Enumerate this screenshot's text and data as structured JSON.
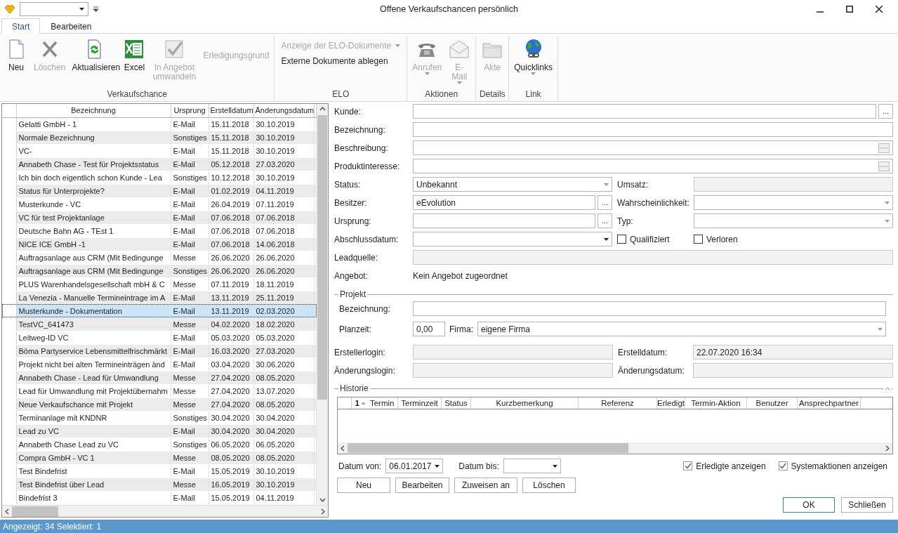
{
  "window": {
    "title": "Offene Verkaufschancen persönlich"
  },
  "tabs": [
    {
      "label": "Start",
      "selected": true
    },
    {
      "label": "Bearbeiten",
      "selected": false
    }
  ],
  "ribbon": {
    "groups": [
      {
        "label": "Verkaufschance",
        "items": [
          {
            "kind": "large",
            "label": "Neu",
            "disabled": false
          },
          {
            "kind": "large",
            "label": "Löschen",
            "disabled": true
          },
          {
            "kind": "large",
            "label": "Aktualisieren",
            "disabled": false
          },
          {
            "kind": "large",
            "label": "Excel",
            "disabled": false
          },
          {
            "kind": "large",
            "label": "In Angebot umwandeln",
            "disabled": true
          },
          {
            "kind": "text",
            "label": "Erledigungsgrund",
            "disabled": true
          }
        ]
      },
      {
        "label": "ELO",
        "items": [
          {
            "kind": "small",
            "label": "Anzeige der ELO-Dokumente",
            "disabled": true,
            "dropdown": true
          },
          {
            "kind": "small",
            "label": "Externe Dokumente ablegen",
            "disabled": false,
            "dropdown": false
          }
        ]
      },
      {
        "label": "Aktionen",
        "items": [
          {
            "kind": "large",
            "label": "Anrufen",
            "disabled": true,
            "dropdown": true
          },
          {
            "kind": "large",
            "label": "E-Mail",
            "disabled": true,
            "dropdown": true
          }
        ]
      },
      {
        "label": "Details",
        "items": [
          {
            "kind": "large",
            "label": "Akte",
            "disabled": true
          }
        ]
      },
      {
        "label": "Link",
        "items": [
          {
            "kind": "large",
            "label": "Quicklinks",
            "disabled": false,
            "dropdown": true
          }
        ]
      }
    ]
  },
  "table": {
    "columns": [
      "Bezeichnung",
      "Ursprung",
      "Erstelldatum",
      "Änderungsdatum"
    ],
    "rows": [
      {
        "bezeichnung": "Gelatti GmbH - 1",
        "ursprung": "E-Mail",
        "erstelldatum": "15.11.2018",
        "aenderungsdatum": "30.10.2019",
        "selected": false
      },
      {
        "bezeichnung": "Normale Bezeichnung",
        "ursprung": "Sonstiges",
        "erstelldatum": "15.11.2018",
        "aenderungsdatum": "30.10.2019",
        "selected": false
      },
      {
        "bezeichnung": "VC-",
        "ursprung": "E-Mail",
        "erstelldatum": "15.11.2018",
        "aenderungsdatum": "30.10.2019",
        "selected": false
      },
      {
        "bezeichnung": "Annabeth Chase - Test für Projektsstatus",
        "ursprung": "E-Mail",
        "erstelldatum": "05.12.2018",
        "aenderungsdatum": "27.03.2020",
        "selected": false
      },
      {
        "bezeichnung": "Ich bin doch eigentlich schon Kunde - Lea",
        "ursprung": "Sonstiges",
        "erstelldatum": "10.12.2018",
        "aenderungsdatum": "30.10.2019",
        "selected": false
      },
      {
        "bezeichnung": "Status für Unterprojekte?",
        "ursprung": "E-Mail",
        "erstelldatum": "01.02.2019",
        "aenderungsdatum": "04.11.2019",
        "selected": false
      },
      {
        "bezeichnung": "Musterkunde  - VC",
        "ursprung": "E-Mail",
        "erstelldatum": "26.04.2019",
        "aenderungsdatum": "07.11.2019",
        "selected": false
      },
      {
        "bezeichnung": "VC für test Projektanlage",
        "ursprung": "E-Mail",
        "erstelldatum": "07.06.2018",
        "aenderungsdatum": "07.06.2018",
        "selected": false
      },
      {
        "bezeichnung": "Deutsche Bahn AG - TEst 1",
        "ursprung": "E-Mail",
        "erstelldatum": "07.06.2018",
        "aenderungsdatum": "07.06.2018",
        "selected": false
      },
      {
        "bezeichnung": "NICE ICE GmbH -1",
        "ursprung": "E-Mail",
        "erstelldatum": "07.06.2018",
        "aenderungsdatum": "14.06.2018",
        "selected": false
      },
      {
        "bezeichnung": "Auftragsanlage aus CRM (Mit Bedingunge",
        "ursprung": "Messe",
        "erstelldatum": "26.06.2020",
        "aenderungsdatum": "26.06.2020",
        "selected": false
      },
      {
        "bezeichnung": "Auftragsanlage aus CRM (Mit Bedingunge",
        "ursprung": "Sonstiges",
        "erstelldatum": "26.06.2020",
        "aenderungsdatum": "26.06.2020",
        "selected": false
      },
      {
        "bezeichnung": "PLUS Warenhandelsgesellschaft mbH & C",
        "ursprung": "Messe",
        "erstelldatum": "07.11.2019",
        "aenderungsdatum": "18.11.2019",
        "selected": false
      },
      {
        "bezeichnung": "La Venezia - Manuelle Termineintrage im A",
        "ursprung": "E-Mail",
        "erstelldatum": "13.11.2019",
        "aenderungsdatum": "25.11.2019",
        "selected": false
      },
      {
        "bezeichnung": "Musterkunde - Dokumentation",
        "ursprung": "E-Mail",
        "erstelldatum": "13.11.2019",
        "aenderungsdatum": "02.03.2020",
        "selected": true
      },
      {
        "bezeichnung": "TestVC_641473",
        "ursprung": "Messe",
        "erstelldatum": "04.02.2020",
        "aenderungsdatum": "18.02.2020",
        "selected": false
      },
      {
        "bezeichnung": "Leitweg-ID VC",
        "ursprung": "E-Mail",
        "erstelldatum": "05.03.2020",
        "aenderungsdatum": "05.03.2020",
        "selected": false
      },
      {
        "bezeichnung": "Böma Partyservice Lebensmittelfrischmärkt",
        "ursprung": "E-Mail",
        "erstelldatum": "16.03.2020",
        "aenderungsdatum": "27.03.2020",
        "selected": false
      },
      {
        "bezeichnung": "Projekt nicht bei alten Termineinträgen änd",
        "ursprung": "E-Mail",
        "erstelldatum": "03.04.2020",
        "aenderungsdatum": "30.06.2020",
        "selected": false
      },
      {
        "bezeichnung": "Annabeth Chase - Lead für Umwandlung",
        "ursprung": "Messe",
        "erstelldatum": "27.04.2020",
        "aenderungsdatum": "08.05.2020",
        "selected": false
      },
      {
        "bezeichnung": "Lead für Umwandlung mit Projektübernahm",
        "ursprung": "Messe",
        "erstelldatum": "27.04.2020",
        "aenderungsdatum": "13.07.2020",
        "selected": false
      },
      {
        "bezeichnung": "Neue Verkaufschance mit Projekt",
        "ursprung": "Messe",
        "erstelldatum": "27.04.2020",
        "aenderungsdatum": "08.05.2020",
        "selected": false
      },
      {
        "bezeichnung": "Terminanlage mit KNDNR",
        "ursprung": "Sonstiges",
        "erstelldatum": "30.04.2020",
        "aenderungsdatum": "30.04.2020",
        "selected": false
      },
      {
        "bezeichnung": "Lead zu VC",
        "ursprung": "E-Mail",
        "erstelldatum": "30.04.2020",
        "aenderungsdatum": "30.04.2020",
        "selected": false
      },
      {
        "bezeichnung": "Annabeth Chase Lead zu VC",
        "ursprung": "Sonstiges",
        "erstelldatum": "06.05.2020",
        "aenderungsdatum": "06.05.2020",
        "selected": false
      },
      {
        "bezeichnung": "Compra GmbH - VC 1",
        "ursprung": "Messe",
        "erstelldatum": "08.05.2020",
        "aenderungsdatum": "08.05.2020",
        "selected": false
      },
      {
        "bezeichnung": "Test Bindefrist",
        "ursprung": "E-Mail",
        "erstelldatum": "15.05.2019",
        "aenderungsdatum": "30.10.2019",
        "selected": false
      },
      {
        "bezeichnung": "Test Bindefrist über Lead",
        "ursprung": "Messe",
        "erstelldatum": "16.05.2019",
        "aenderungsdatum": "30.10.2019",
        "selected": false
      },
      {
        "bezeichnung": "Bindefrist 3",
        "ursprung": "E-Mail",
        "erstelldatum": "15.05.2019",
        "aenderungsdatum": "04.11.2019",
        "selected": false
      }
    ]
  },
  "details": {
    "kunde": {
      "label": "Kunde:",
      "browse": "..."
    },
    "bezeichnung": {
      "label": "Bezeichnung:"
    },
    "beschreibung": {
      "label": "Beschreibung:"
    },
    "produktinteresse": {
      "label": "Produktinteresse:"
    },
    "status": {
      "label": "Status:",
      "value": "Unbekannt"
    },
    "umsatz": {
      "label": "Umsatz:",
      "readonly": true
    },
    "besitzer": {
      "label": "Besitzer:",
      "value": "eEvolution",
      "browse": "..."
    },
    "wahrscheinlichkeit": {
      "label": "Wahrscheinlichkeit:"
    },
    "ursprung": {
      "label": "Ursprung:",
      "browse": "..."
    },
    "typ": {
      "label": "Typ:"
    },
    "abschlussdatum": {
      "label": "Abschlussdatum:"
    },
    "qualifiziert": {
      "label": "Qualifiziert",
      "checked": false
    },
    "verloren": {
      "label": "Verloren",
      "checked": false
    },
    "leadquelle": {
      "label": "Leadquelle:",
      "readonly": true
    },
    "angebot": {
      "label": "Angebot:",
      "value": "Kein Angebot zugeordnet"
    }
  },
  "projekt": {
    "title": "Projekt",
    "bezeichnung": {
      "label": "Bezeichnung:"
    },
    "planzeit": {
      "label": "Planzeit:",
      "value": "0,00"
    },
    "firma": {
      "label": "Firma:",
      "value": "eigene Firma"
    }
  },
  "audit": {
    "erstellerlogin": {
      "label": "Erstellerlogin:",
      "readonly": true
    },
    "erstelldatum": {
      "label": "Erstelldatum:",
      "value": "22.07.2020 16:34",
      "readonly": true
    },
    "aenderungslogin": {
      "label": "Änderungslogin:",
      "readonly": true
    },
    "aenderungsdatum": {
      "label": "Änderungsdatum:",
      "readonly": true
    }
  },
  "historie": {
    "title": "Historie",
    "sort_index": "1",
    "columns": [
      "Termin",
      "Terminzeit",
      "Status",
      "Kurzbemerkung",
      "Referenz",
      "Erledigt",
      "Termin-Aktion",
      "Benutzer",
      "Ansprechpartner"
    ],
    "datum_von": {
      "label": "Datum von:",
      "value": "06.01.2017"
    },
    "datum_bis": {
      "label": "Datum bis:"
    },
    "erledigte": {
      "label": "Erledigte anzeigen",
      "checked": true
    },
    "systemaktionen": {
      "label": "Systemaktionen anzeigen",
      "checked": true
    },
    "buttons": [
      "Neu",
      "Bearbeiten",
      "Zuweisen an",
      "Löschen"
    ]
  },
  "dialog_buttons": [
    "OK",
    "Schließen"
  ],
  "status_bar": {
    "text": "Angezeigt: 34 Selektiert: 1"
  }
}
